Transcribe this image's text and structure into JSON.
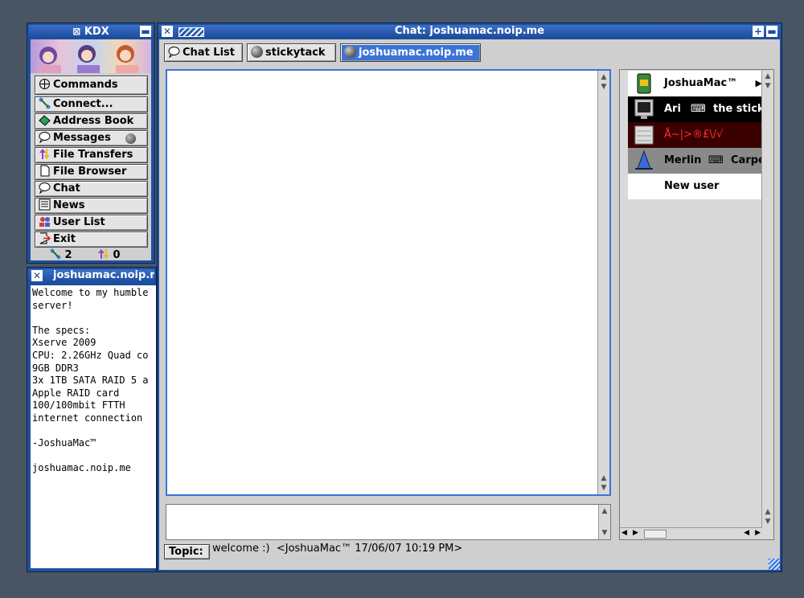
{
  "kdx_window": {
    "title": "KDX",
    "menu": [
      {
        "label": "Commands",
        "icon": "commands-icon"
      },
      {
        "label": "Connect...",
        "icon": "connect-icon"
      },
      {
        "label": "Address Book",
        "icon": "address-book-icon"
      },
      {
        "label": "Messages",
        "icon": "messages-icon"
      },
      {
        "label": "File Transfers",
        "icon": "file-transfers-icon"
      },
      {
        "label": "File Browser",
        "icon": "file-browser-icon"
      },
      {
        "label": "Chat",
        "icon": "chat-icon"
      },
      {
        "label": "News",
        "icon": "news-icon"
      },
      {
        "label": "User List",
        "icon": "user-list-icon"
      },
      {
        "label": "Exit",
        "icon": "exit-icon"
      }
    ],
    "status": {
      "connections": "2",
      "transfers": "0"
    }
  },
  "agreement_window": {
    "title": "joshuamac.noip.me",
    "text": "Welcome to my humble\nserver!\n\nThe specs:\nXserve 2009\nCPU: 2.26GHz Quad co\n9GB DDR3\n3x 1TB SATA RAID 5 a\nApple RAID card\n100/100mbit FTTH\ninternet connection\n\n-JoshuaMac™\n\njoshuamac.noip.me"
  },
  "chat_window": {
    "title": "Chat: joshuamac.noip.me",
    "tabs": [
      {
        "label": "Chat List",
        "icon": "chat-bubble-icon"
      },
      {
        "label": "stickytack",
        "icon": "sphere-icon"
      },
      {
        "label": "joshuamac.noip.me",
        "icon": "sphere-icon"
      }
    ],
    "topic_button": "Topic:",
    "topic_text": "welcome :)  <JoshuaMac™ 17/06/07 10:19 PM>",
    "users": [
      {
        "name": "JoshuaMac™",
        "status": "",
        "color": "#f05a5a"
      },
      {
        "name": "Ari",
        "status": "the stick",
        "color": "#f0a060"
      },
      {
        "name": "Å~|>®£\\/√",
        "status": "",
        "color": "#f0a060"
      },
      {
        "name": "Merlin",
        "status": "Carpe",
        "color": "#f0a060"
      },
      {
        "name": "New user",
        "status": "",
        "color": "#f0a060"
      }
    ]
  },
  "colors": {
    "accent": "#1f4f9a",
    "desktop": "#4a5563",
    "selected_tab": "#3a74d8"
  }
}
